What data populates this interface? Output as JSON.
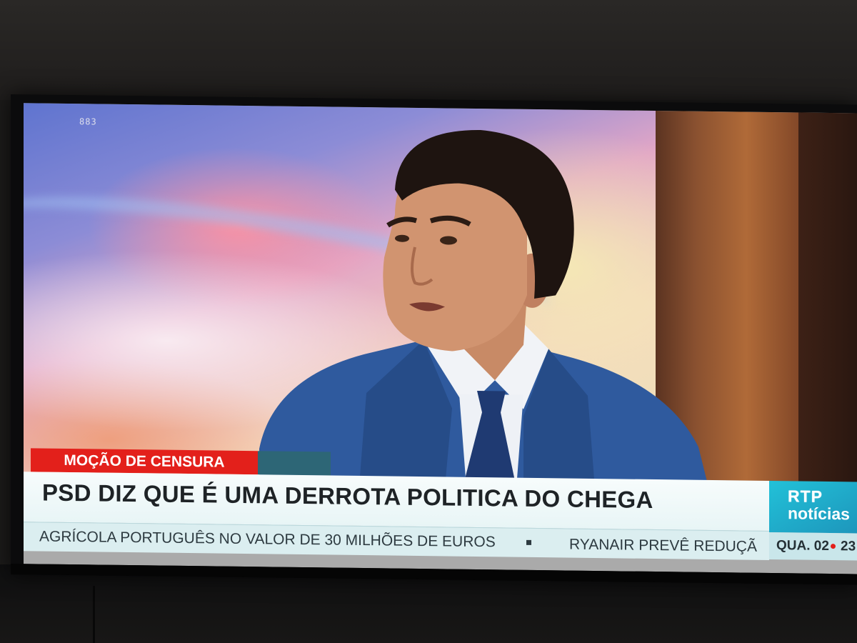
{
  "broadcast": {
    "channel_tag": "883",
    "topic_label": "MOÇÃO DE CENSURA",
    "headline": "PSD DIZ QUE É UMA DERROTA POLITICA DO CHEGA",
    "ticker": {
      "item_1": "AGRÍCOLA PORTUGUÊS NO VALOR DE 30 MILHÕES DE EUROS",
      "item_2": "RYANAIR PREVÊ REDUÇÃ"
    },
    "logo": {
      "line_1": "RTP",
      "line_2": "notícias"
    },
    "date": "QUA. 02",
    "time": "23"
  },
  "colors": {
    "topic_red": "#e3201b",
    "logo_cyan": "#22c1d8",
    "suit_blue": "#2f5a9e"
  }
}
